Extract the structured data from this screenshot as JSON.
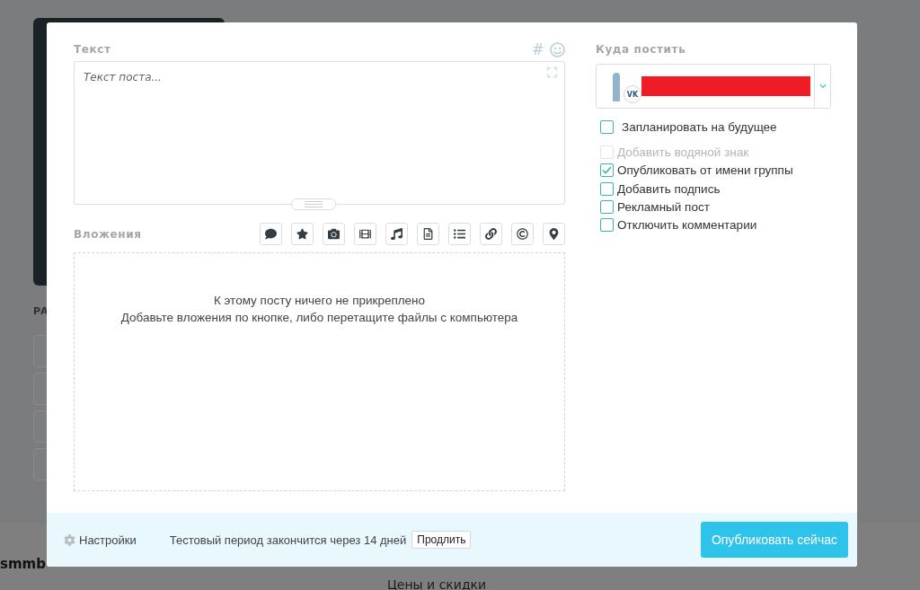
{
  "background": {
    "section_label": "РА",
    "brand": "smmb",
    "footer_link": "Цены и скидки"
  },
  "editor": {
    "label": "Текст",
    "hashtag_symbol": "#",
    "placeholder": "Текст поста..."
  },
  "attachments": {
    "label": "Вложения",
    "empty_title": "К этому посту ничего не прикреплено",
    "empty_hint": "Добавьте вложения по кнопке, либо перетащите файлы с компьютера"
  },
  "target": {
    "label": "Куда постить",
    "network_badge": "VK"
  },
  "options": [
    {
      "label": "Запланировать на будущее",
      "checked": false,
      "disabled": false
    },
    {
      "label": "Добавить водяной знак",
      "checked": false,
      "disabled": true
    },
    {
      "label": "Опубликовать от имени группы",
      "checked": true,
      "disabled": false
    },
    {
      "label": "Добавить подпись",
      "checked": false,
      "disabled": false
    },
    {
      "label": "Рекламный пост",
      "checked": false,
      "disabled": false
    },
    {
      "label": "Отключить комментарии",
      "checked": false,
      "disabled": false
    }
  ],
  "footer": {
    "settings": "Настройки",
    "trial_notice": "Тестовый период закончится через 14 дней",
    "extend_button": "Продлить",
    "publish_button": "Опубликовать сейчас"
  }
}
